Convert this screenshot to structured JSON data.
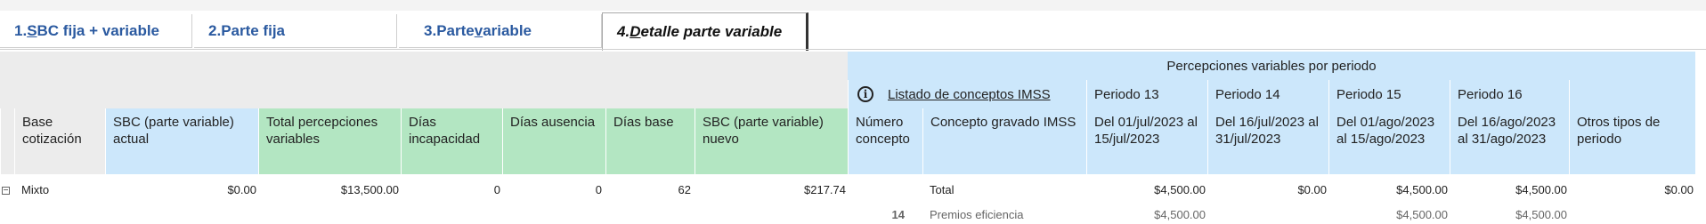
{
  "tabs": [
    {
      "num": "1.",
      "ul": "S",
      "rest": "BC fija + variable"
    },
    {
      "num": "2.",
      "ul": "",
      "rest": "Parte fija"
    },
    {
      "num": "3.",
      "pre": "Parte ",
      "ul": "v",
      "rest": "ariable"
    },
    {
      "num": "4.",
      "ul": "D",
      "rest": "etalle parte variable"
    }
  ],
  "group_header": "Percepciones variables por periodo",
  "listado_link": "Listado de conceptos IMSS",
  "periods": [
    "Periodo 13",
    "Periodo 14",
    "Periodo 15",
    "Periodo 16"
  ],
  "columns": {
    "base": "Base cotización",
    "sbc_actual": "SBC (parte variable) actual",
    "total_percepciones": "Total percepciones variables",
    "dias_incapacidad": "Días incapacidad",
    "dias_ausencia": "Días ausencia",
    "dias_base": "Días base",
    "sbc_nuevo": "SBC (parte variable) nuevo",
    "numero_concepto": "Número concepto",
    "concepto_gravado": "Concepto gravado IMSS",
    "p13": "Del 01/jul/2023 al 15/jul/2023",
    "p14": "Del 16/jul/2023 al 31/jul/2023",
    "p15": "Del 01/ago/2023 al 15/ago/2023",
    "p16": "Del 16/ago/2023 al 31/ago/2023",
    "otros": "Otros tipos de periodo"
  },
  "rows": {
    "summary": {
      "expander": "⊟",
      "base": "Mixto",
      "sbc_actual": "$0.00",
      "total_percepciones": "$13,500.00",
      "dias_incapacidad": "0",
      "dias_ausencia": "0",
      "dias_base": "62",
      "sbc_nuevo": "$217.74",
      "concepto": "Total",
      "p13": "$4,500.00",
      "p14": "$0.00",
      "p15": "$4,500.00",
      "p16": "$4,500.00",
      "otros": "$0.00"
    },
    "detail": {
      "numero": "14",
      "concepto": "Premios eficiencia",
      "p13": "$4,500.00",
      "p15": "$4,500.00",
      "p16": "$4,500.00"
    }
  },
  "colors": {
    "blue_header": "#cce7fb",
    "green_header": "#b3e6c2",
    "grey_header": "#ececec",
    "tab_text": "#2b5aa0"
  }
}
